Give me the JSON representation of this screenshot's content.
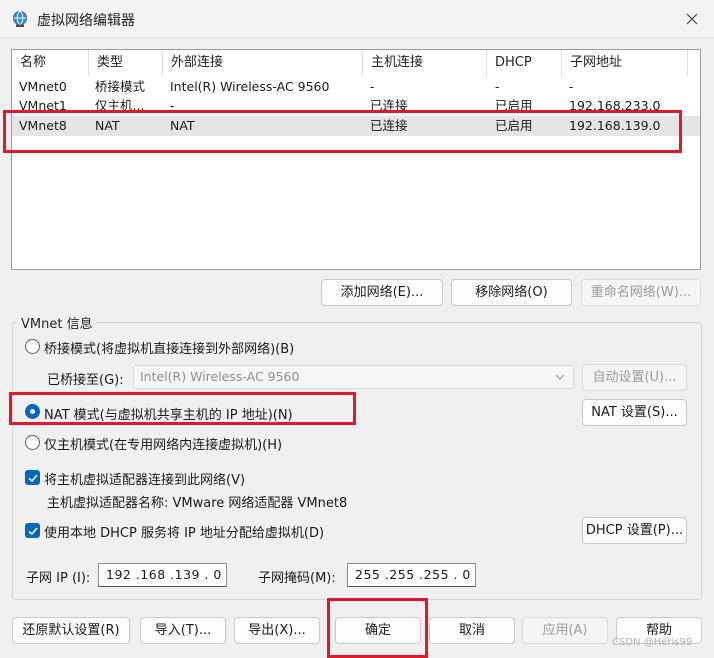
{
  "window": {
    "title": "虚拟网络编辑器"
  },
  "table": {
    "headers": [
      "名称",
      "类型",
      "外部连接",
      "主机连接",
      "DHCP",
      "子网地址"
    ],
    "rows": [
      [
        "VMnet0",
        "桥接模式",
        "Intel(R) Wireless-AC 9560",
        "-",
        "-",
        "-"
      ],
      [
        "VMnet1",
        "仅主机...",
        "-",
        "已连接",
        "已启用",
        "192.168.233.0"
      ],
      [
        "VMnet8",
        "NAT",
        "NAT",
        "已连接",
        "已启用",
        "192.168.139.0"
      ]
    ],
    "selected_row": 2
  },
  "network_buttons": {
    "add": "添加网络(E)...",
    "remove": "移除网络(O)",
    "rename": "重命名网络(W)..."
  },
  "vmnet_info": {
    "group_label": "VMnet 信息",
    "bridge_mode": "桥接模式(将虚拟机直接连接到外部网络)(B)",
    "bridged_to_label": "已桥接至(G):",
    "bridged_to_value": "Intel(R) Wireless-AC 9560",
    "auto_settings": "自动设置(U)...",
    "nat_mode": "NAT 模式(与虚拟机共享主机的 IP 地址)(N)",
    "nat_settings": "NAT 设置(S)...",
    "host_only_mode": "仅主机模式(在专用网络内连接虚拟机)(H)",
    "connect_adapter": "将主机虚拟适配器连接到此网络(V)",
    "adapter_name": "主机虚拟适配器名称: VMware 网络适配器 VMnet8",
    "use_dhcp": "使用本地 DHCP 服务将 IP 地址分配给虚拟机(D)",
    "dhcp_settings": "DHCP 设置(P)...",
    "subnet_ip_label": "子网 IP (I):",
    "subnet_ip_value": "192 .168 .139 .  0",
    "subnet_mask_label": "子网掩码(M):",
    "subnet_mask_value": "255 .255 .255 .  0",
    "selected_mode": "nat",
    "connect_adapter_checked": true,
    "use_dhcp_checked": true
  },
  "footer": {
    "restore_defaults": "还原默认设置(R)",
    "import": "导入(T)...",
    "export": "导出(X)...",
    "ok": "确定",
    "cancel": "取消",
    "apply": "应用(A)",
    "help": "帮助"
  },
  "watermark": "CSDN @Heris99",
  "colors": {
    "accent": "#0067c0",
    "highlight_box": "#e0192a",
    "selected_row": "#e5e5e5"
  }
}
